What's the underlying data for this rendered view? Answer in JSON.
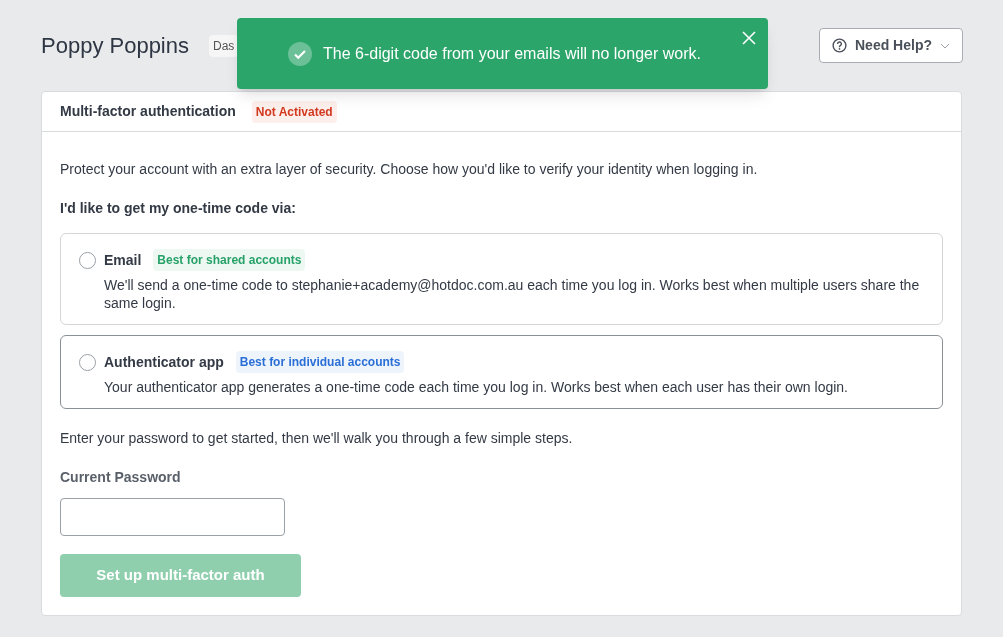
{
  "header": {
    "title": "Poppy Poppins",
    "badge": "Das",
    "help_button": "Need Help?"
  },
  "toast": {
    "message": "The 6-digit code from your emails will no longer work."
  },
  "card": {
    "title": "Multi-factor authentication",
    "status": "Not Activated",
    "intro": "Protect your account with an extra layer of security. Choose how you'd like to verify your identity when logging in.",
    "question": "I'd like to get my one-time code via:",
    "options": [
      {
        "label": "Email",
        "tag": "Best for shared accounts",
        "color": "#26a269",
        "selected": false,
        "hovered": false,
        "description": "We'll send a one-time code to stephanie+academy@hotdoc.com.au each time you log in. Works best when multiple users share the same login."
      },
      {
        "label": "Authenticator app",
        "tag": "Best for individual accounts",
        "color": "#2a6fd6",
        "selected": false,
        "hovered": true,
        "description": "Your authenticator app generates a one-time code each time you log in. Works best when each user has their own login."
      }
    ],
    "hint": "Enter your password to get started, then we'll walk you through a few simple steps.",
    "password_label": "Current Password",
    "submit": {
      "label": "Set up multi-factor auth",
      "disabled": true
    }
  }
}
